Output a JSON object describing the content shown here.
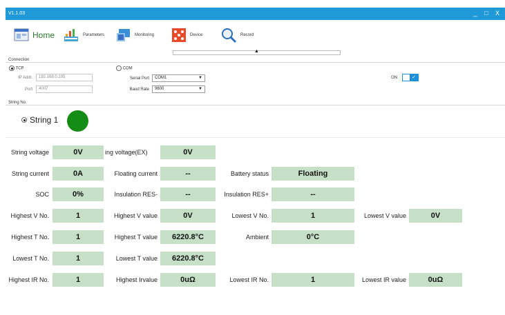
{
  "window": {
    "title": "V1.1.03",
    "controls": [
      "_",
      "□",
      "X"
    ]
  },
  "toolbar": {
    "home": "Home",
    "parameters": "Parameters",
    "monitoring": "Monitoring",
    "device": "Device",
    "record": "Record"
  },
  "connection": {
    "group_label": "Connection",
    "tcp_label": "TCP",
    "com_label": "COM",
    "ip_label": "IP Addr.",
    "ip_value": "192.168.0.105",
    "port_label": "Port",
    "port_value": "4007",
    "serial_port_label": "Serial Port",
    "serial_port_value": "COM1",
    "baud_rate_label": "Baud Rate",
    "baud_rate_value": "9600",
    "on_label": "ON",
    "toggle_checked": true
  },
  "string": {
    "group_label": "String No.",
    "option_label": "String 1",
    "status_color": "#158c15"
  },
  "metrics": {
    "string_voltage": {
      "label": "String voltage",
      "value": "0V"
    },
    "string_voltage_ex": {
      "label": "ing voltage(EX)",
      "value": "0V"
    },
    "string_current": {
      "label": "String current",
      "value": "0A"
    },
    "floating_current": {
      "label": "Floating current",
      "value": "--"
    },
    "battery_status": {
      "label": "Battery status",
      "value": "Floating"
    },
    "soc": {
      "label": "SOC",
      "value": "0%"
    },
    "insulation_res_minus": {
      "label": "Insulation RES-",
      "value": "--"
    },
    "insulation_res_plus": {
      "label": "Insulation RES+",
      "value": "--"
    },
    "highest_v_no": {
      "label": "Highest V No.",
      "value": "1"
    },
    "highest_v_value": {
      "label": "Highest V value",
      "value": "0V"
    },
    "lowest_v_no": {
      "label": "Lowest V No.",
      "value": "1"
    },
    "lowest_v_value": {
      "label": "Lowest V value",
      "value": "0V"
    },
    "highest_t_no": {
      "label": "Highest T No.",
      "value": "1"
    },
    "highest_t_value": {
      "label": "Highest T value",
      "value": "6220.8°C"
    },
    "ambient": {
      "label": "Ambient",
      "value": "0°C"
    },
    "lowest_t_no": {
      "label": "Lowest T No.",
      "value": "1"
    },
    "lowest_t_value": {
      "label": "Lowest T value",
      "value": "6220.8°C"
    },
    "highest_ir_no": {
      "label": "Highest IR No.",
      "value": "1"
    },
    "highest_ir_value": {
      "label": "Highest Irvalue",
      "value": "0uΩ"
    },
    "lowest_ir_no": {
      "label": "Lowest IR No.",
      "value": "1"
    },
    "lowest_ir_value": {
      "label": "Lowest IR value",
      "value": "0uΩ"
    }
  },
  "colors": {
    "titlebar": "#1f9ad6",
    "value_bg": "#c6e0c7",
    "accent": "#1e8fd9"
  }
}
